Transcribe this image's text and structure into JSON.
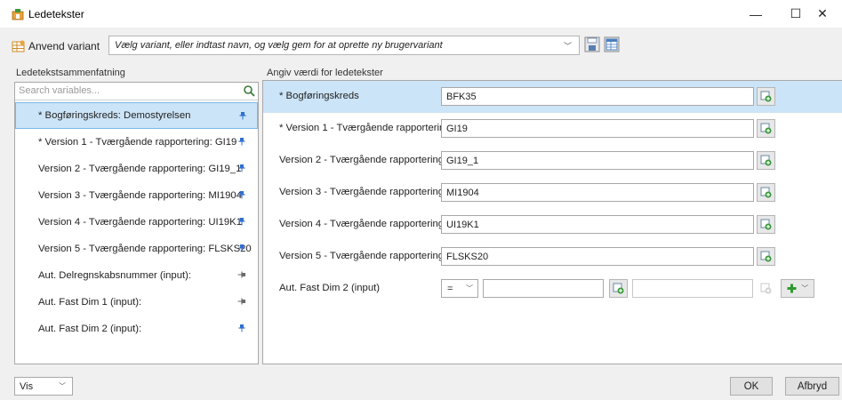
{
  "window": {
    "title": "Ledetekster",
    "minimize_glyph": "—",
    "maximize_glyph": "☐",
    "close_glyph": "✕"
  },
  "variant": {
    "label": "Anvend variant",
    "placeholder": "Vælg variant, eller indtast navn, og vælg gem for at oprette ny brugervariant"
  },
  "left": {
    "caption": "Ledetekstsammenfatning",
    "search_placeholder": "Search variables...",
    "items": [
      {
        "label": "* Bogføringskreds: Demostyrelsen",
        "pin": "pinned"
      },
      {
        "label": "* Version 1 - Tværgående rapportering: GI19",
        "pin": "pinned"
      },
      {
        "label": "Version 2 - Tværgående rapportering: GI19_1",
        "pin": "pinned"
      },
      {
        "label": "Version 3 - Tværgående rapportering: MI1904",
        "pin": "pinned"
      },
      {
        "label": "Version 4 - Tværgående rapportering: UI19K1",
        "pin": "pinned"
      },
      {
        "label": "Version 5 - Tværgående rapportering: FLSKS20",
        "pin": "pinned"
      },
      {
        "label": "Aut. Delregnskabsnummer (input):",
        "pin": "unpinned"
      },
      {
        "label": "Aut. Fast Dim 1 (input):",
        "pin": "unpinned"
      },
      {
        "label": "Aut. Fast Dim 2 (input):",
        "pin": "pinned"
      }
    ]
  },
  "right": {
    "caption": "Angiv værdi for ledetekster",
    "rows": [
      {
        "label": "* Bogføringskreds",
        "value": "BFK35"
      },
      {
        "label": "* Version 1 - Tværgående rapportering",
        "value": "GI19"
      },
      {
        "label": "Version 2 - Tværgående rapportering",
        "value": "GI19_1"
      },
      {
        "label": "Version 3 - Tværgående rapportering",
        "value": "MI1904"
      },
      {
        "label": "Version 4 - Tværgående rapportering",
        "value": "UI19K1"
      },
      {
        "label": "Version 5 - Tværgående rapportering",
        "value": "FLSKS20"
      }
    ],
    "range_row": {
      "label": "Aut. Fast Dim 2 (input)",
      "operator": "=",
      "from": "",
      "to": ""
    }
  },
  "footer": {
    "vis_label": "Vis",
    "ok_label": "OK",
    "cancel_label": "Afbryd"
  },
  "colors": {
    "selection": "#cce4f7",
    "selection_border": "#7ab8e8",
    "pin_blue": "#2f6fd0",
    "lookup_green": "#3a9a3a"
  }
}
